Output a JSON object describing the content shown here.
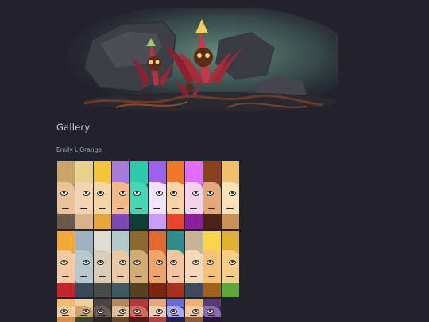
{
  "page": {
    "section_title": "Gallery",
    "artist_name": "Emily L'Orange"
  },
  "banner": {
    "icon": "flower-creature-illustration",
    "accent": "#c2344a",
    "glow": "#5c8a7a"
  },
  "gallery": {
    "rows": [
      [
        {
          "bg": "#8a8f7a",
          "hair": "#c9a36a",
          "face": "#e9c29a",
          "bottom": "#6a5a4a"
        },
        {
          "bg": "#e6e0d2",
          "hair": "#e7d48a",
          "face": "#f2d3b2",
          "bottom": "#d9b28b"
        },
        {
          "bg": "#f0e6a8",
          "hair": "#f4c53a",
          "face": "#f3d7a9",
          "bottom": "#e6a63a"
        },
        {
          "bg": "#f6c9a0",
          "hair": "#a77bd9",
          "face": "#f4b98b",
          "bottom": "#7d4ab3"
        },
        {
          "bg": "#1e7a6e",
          "hair": "#2dc9a8",
          "face": "#4ad4b5",
          "bottom": "#0d3e38"
        },
        {
          "bg": "#e7d6f6",
          "hair": "#9a63e8",
          "face": "#f1e3ff",
          "bottom": "#c89df5"
        },
        {
          "bg": "#f5a63a",
          "hair": "#f0762a",
          "face": "#f8d4a6",
          "bottom": "#e8452f"
        },
        {
          "bg": "#cf4bd3",
          "hair": "#e26cff",
          "face": "#f4d2ec",
          "bottom": "#8b1e9a"
        },
        {
          "bg": "#6a3a2a",
          "hair": "#8a3f1e",
          "face": "#e2a77a",
          "bottom": "#4a2316"
        },
        {
          "bg": "#f4d48a",
          "hair": "#f2c06a",
          "face": "#f8e2b8",
          "bottom": "#c9925a"
        }
      ],
      [
        {
          "bg": "#f9efe0",
          "hair": "#f2a83a",
          "face": "#f5c9a2",
          "bottom": "#c2272d"
        },
        {
          "bg": "#7a8a9a",
          "hair": "#9eb2c1",
          "face": "#b9c7cf",
          "bottom": "#3b4a58"
        },
        {
          "bg": "#b7b3a6",
          "hair": "#e0dccf",
          "face": "#d8cdb6",
          "bottom": "#4a4a48"
        },
        {
          "bg": "#8ab0b6",
          "hair": "#b0c9c9",
          "face": "#e9c9a4",
          "bottom": "#3e5a60"
        },
        {
          "bg": "#b89056",
          "hair": "#8a6a2f",
          "face": "#d1ad74",
          "bottom": "#5a4020"
        },
        {
          "bg": "#c9421f",
          "hair": "#e06a2c",
          "face": "#f0a36a",
          "bottom": "#7e2510"
        },
        {
          "bg": "#4a6a66",
          "hair": "#2f8e8a",
          "face": "#f2c5a0",
          "bottom": "#a3321e"
        },
        {
          "bg": "#f0e5d0",
          "hair": "#c8b394",
          "face": "#f5d8b8",
          "bottom": "#404a5a"
        },
        {
          "bg": "#f5c33a",
          "hair": "#f8d44a",
          "face": "#f6c27a",
          "bottom": "#a0621a"
        },
        {
          "bg": "#f7e37a",
          "hair": "#e0b230",
          "face": "#f5cf85",
          "bottom": "#5ea73a"
        }
      ],
      [
        {
          "bg": "#f9dfb0",
          "hair": "#f5b96a",
          "face": "#f3cf9d",
          "bottom": "#d88e4a"
        },
        {
          "bg": "#e9c47e",
          "hair": "#f0d398",
          "face": "#d1a16a",
          "bottom": "#3a4430"
        },
        {
          "bg": "#3a3432",
          "hair": "#4d443f",
          "face": "#6a5a52",
          "bottom": "#2a2422"
        },
        {
          "bg": "#e8d2b8",
          "hair": "#b58a58",
          "face": "#dcbf98",
          "bottom": "#6a4a2a"
        },
        {
          "bg": "#8a2a2a",
          "hair": "#b23a3a",
          "face": "#d36a5a",
          "bottom": "#5a1818"
        },
        {
          "bg": "#f2e0d0",
          "hair": "#e8a67a",
          "face": "#f3cfb0",
          "bottom": "#b24242"
        },
        {
          "bg": "#3a3a6a",
          "hair": "#6a6ad4",
          "face": "#a8a8f0",
          "bottom": "#23234a"
        },
        {
          "bg": "#f7d6b5",
          "hair": "#f2b070",
          "face": "#f4c8a0",
          "bottom": "#8a5a3a"
        },
        {
          "bg": "#3a2a4a",
          "hair": "#5a3a7a",
          "face": "#8a6ab0",
          "bottom": "#241834"
        }
      ]
    ]
  }
}
